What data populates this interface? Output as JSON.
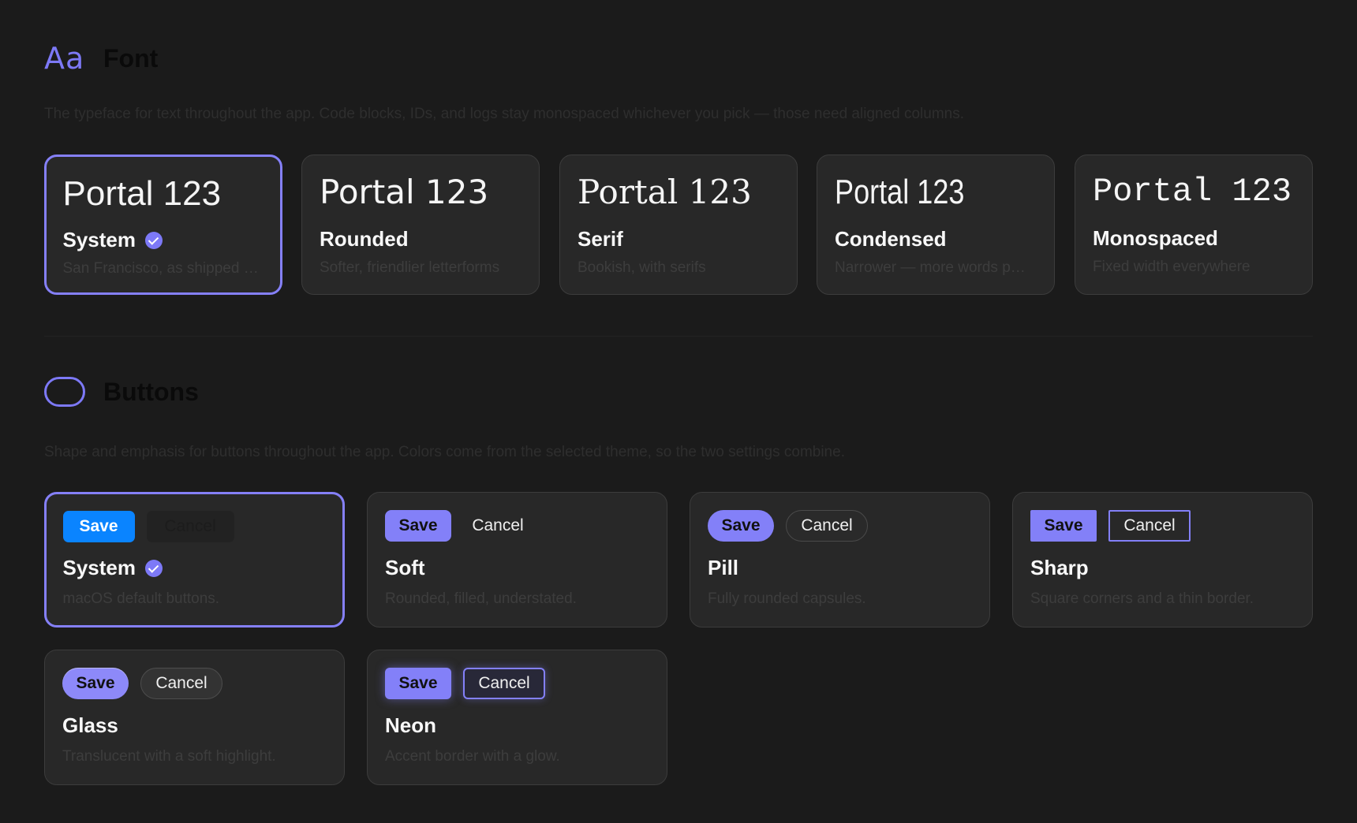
{
  "font_section": {
    "icon": "Aa",
    "title": "Font",
    "description": "The typeface for text throughout the app. Code blocks, IDs, and logs stay monospaced whichever you pick — those need aligned columns.",
    "sample_text": "Portal 123",
    "options": [
      {
        "name": "System",
        "subtitle": "San Francisco, as shipped with macOS",
        "selected": true
      },
      {
        "name": "Rounded",
        "subtitle": "Softer, friendlier letterforms",
        "selected": false
      },
      {
        "name": "Serif",
        "subtitle": "Bookish, with serifs",
        "selected": false
      },
      {
        "name": "Condensed",
        "subtitle": "Narrower — more words per line",
        "selected": false
      },
      {
        "name": "Monospaced",
        "subtitle": "Fixed width everywhere",
        "selected": false
      }
    ]
  },
  "buttons_section": {
    "icon": "capsule-icon",
    "title": "Buttons",
    "description": "Shape and emphasis for buttons throughout the app. Colors come from the selected theme, so the two settings combine.",
    "save_label": "Save",
    "cancel_label": "Cancel",
    "options": [
      {
        "name": "System",
        "subtitle": "macOS default buttons.",
        "selected": true
      },
      {
        "name": "Soft",
        "subtitle": "Rounded, filled, understated.",
        "selected": false
      },
      {
        "name": "Pill",
        "subtitle": "Fully rounded capsules.",
        "selected": false
      },
      {
        "name": "Sharp",
        "subtitle": "Square corners and a thin border.",
        "selected": false
      },
      {
        "name": "Glass",
        "subtitle": "Translucent with a soft highlight.",
        "selected": false
      },
      {
        "name": "Neon",
        "subtitle": "Accent border with a glow.",
        "selected": false
      }
    ]
  },
  "colors": {
    "accent": "#7d79f7",
    "system_blue": "#0a84ff",
    "background": "#1b1b1b",
    "card": "#282828"
  }
}
